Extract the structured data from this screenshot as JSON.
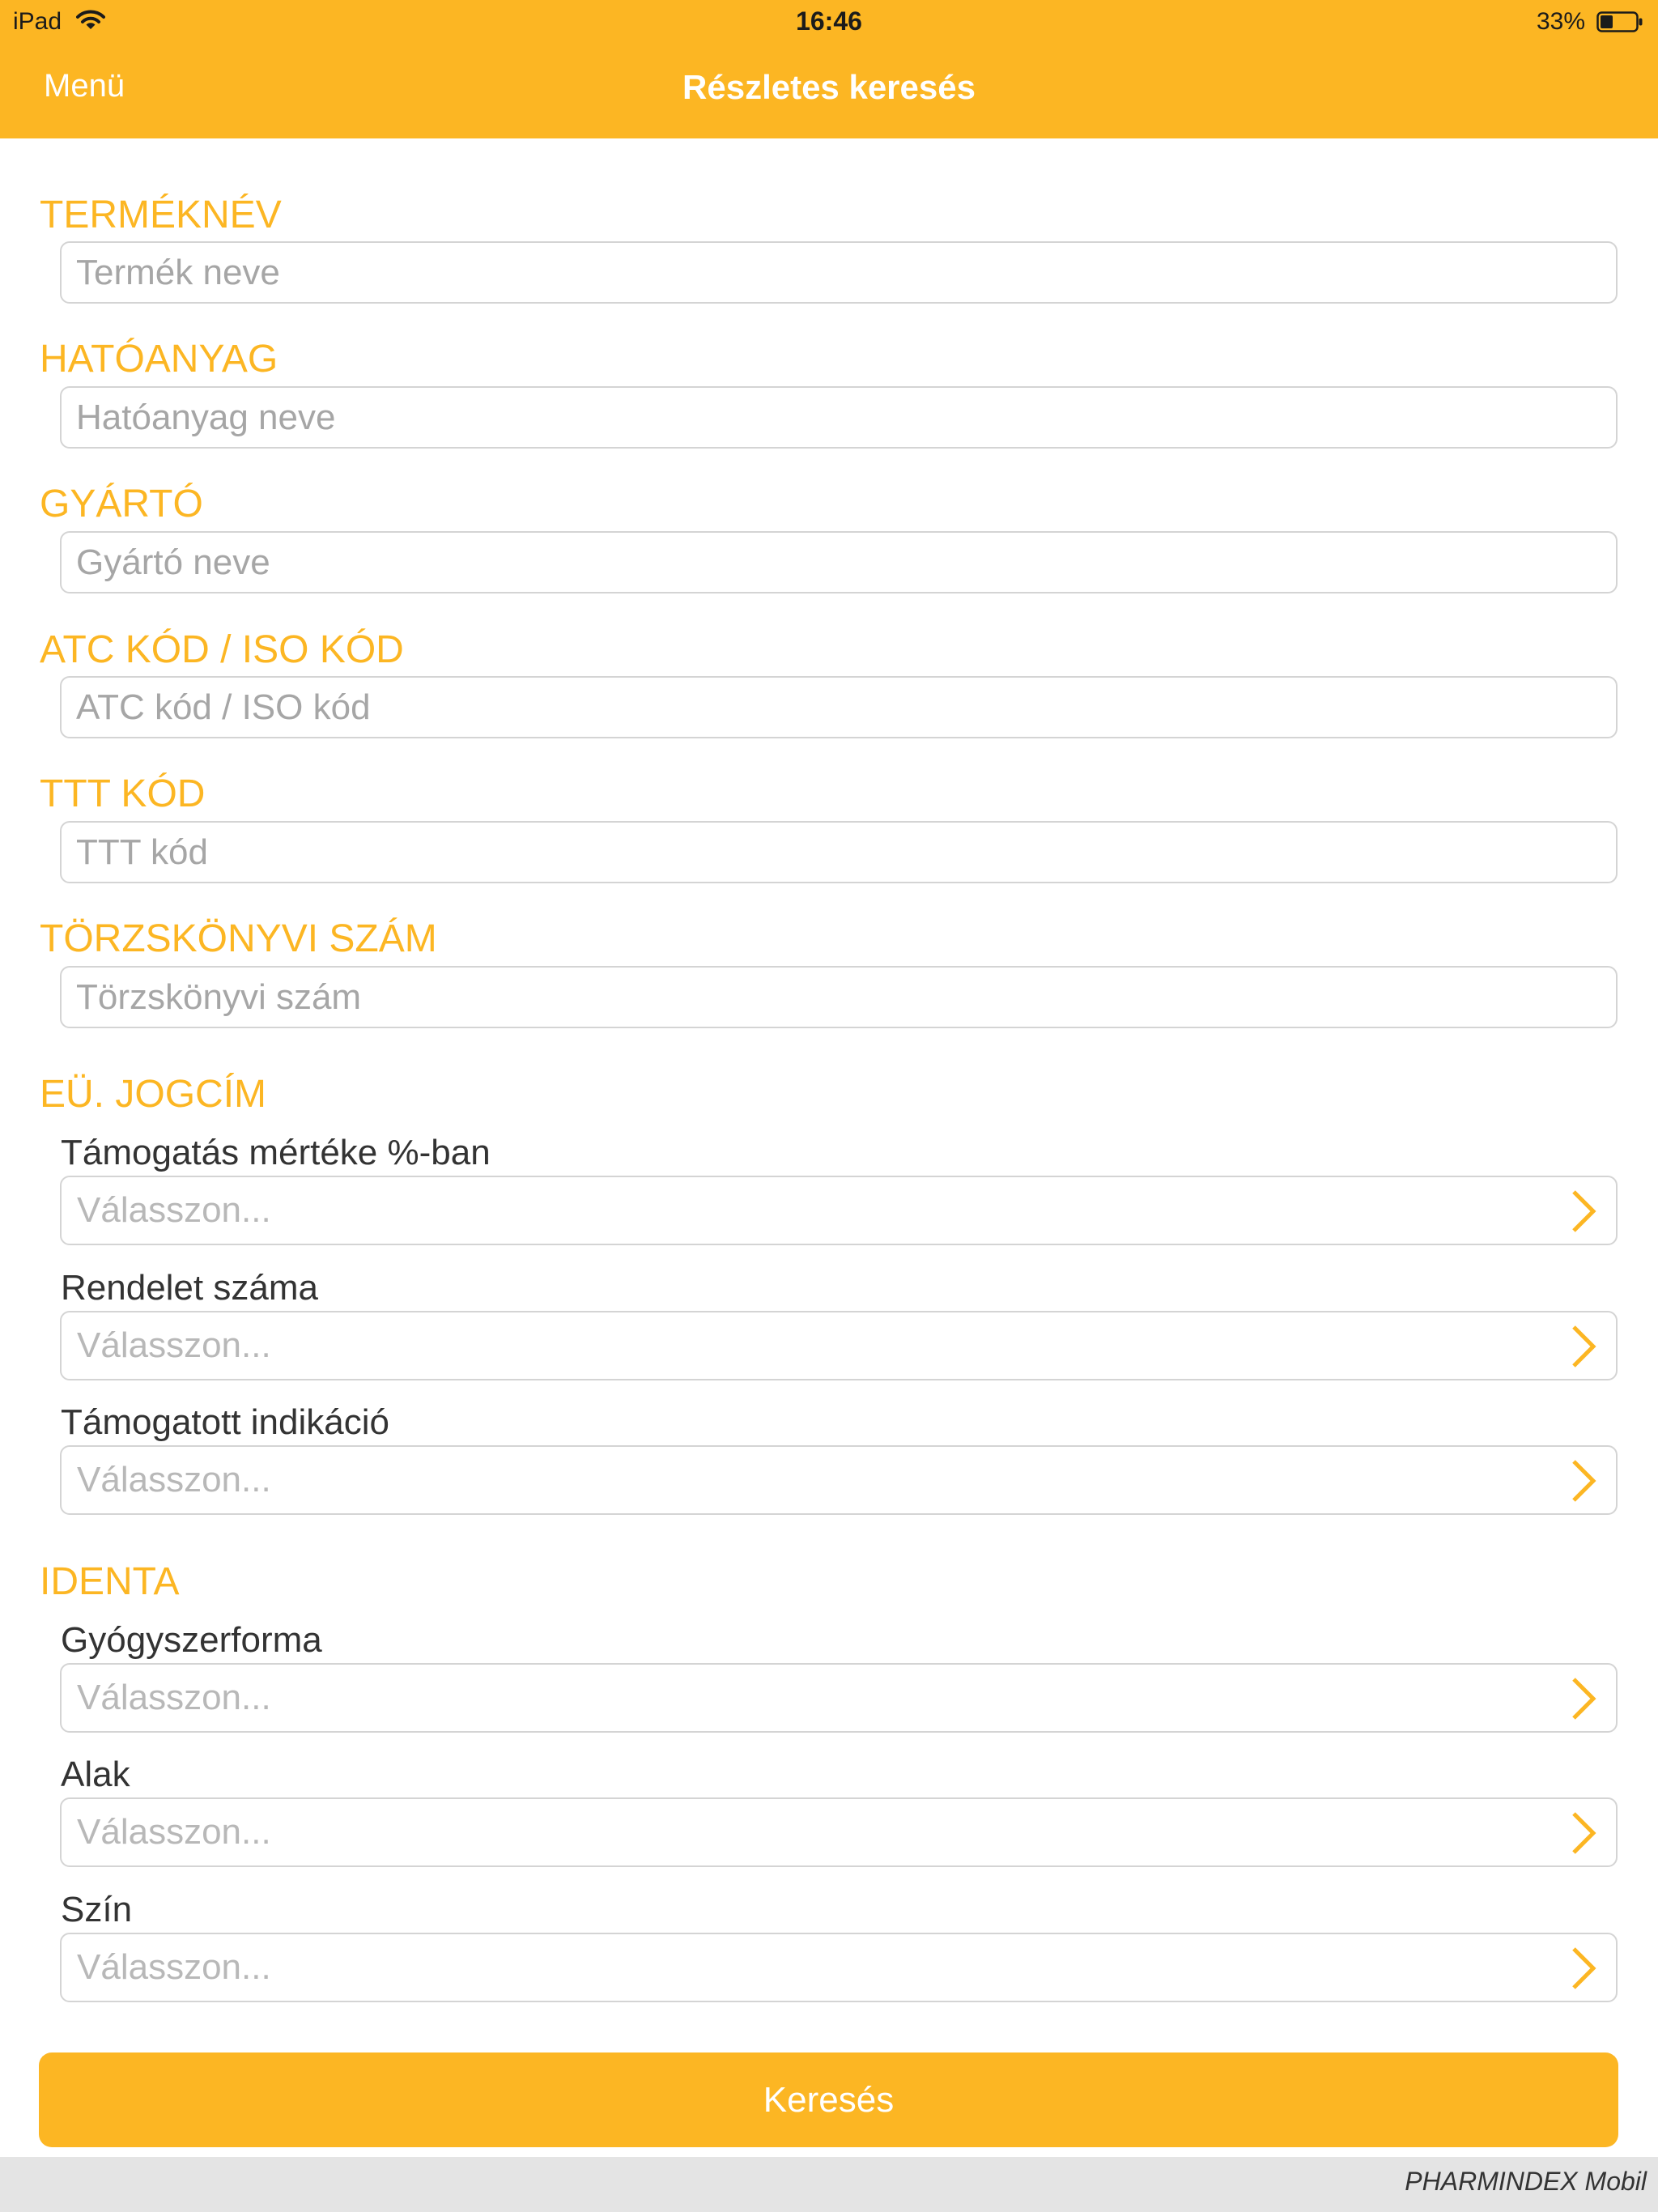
{
  "status_bar": {
    "device": "iPad",
    "time": "16:46",
    "battery": "33%"
  },
  "nav": {
    "menu_label": "Menü",
    "title": "Részletes keresés"
  },
  "fields": {
    "termeknev": {
      "label": "TERMÉKNÉV",
      "placeholder": "Termék neve"
    },
    "hatoanyag": {
      "label": "HATÓANYAG",
      "placeholder": "Hatóanyag neve"
    },
    "gyarto": {
      "label": "GYÁRTÓ",
      "placeholder": "Gyártó neve"
    },
    "atc": {
      "label": "ATC KÓD / ISO KÓD",
      "placeholder": "ATC kód / ISO kód"
    },
    "ttt": {
      "label": "TTT KÓD",
      "placeholder": "TTT kód"
    },
    "torzskonyvi": {
      "label": "TÖRZSKÖNYVI SZÁM",
      "placeholder": "Törzskönyvi szám"
    }
  },
  "eu_jogcim": {
    "label": "EÜ. JOGCÍM",
    "selects": [
      {
        "label": "Támogatás mértéke %-ban",
        "placeholder": "Válasszon..."
      },
      {
        "label": "Rendelet száma",
        "placeholder": "Válasszon..."
      },
      {
        "label": "Támogatott indikáció",
        "placeholder": "Válasszon..."
      }
    ]
  },
  "identa": {
    "label": "IDENTA",
    "selects": [
      {
        "label": "Gyógyszerforma",
        "placeholder": "Válasszon..."
      },
      {
        "label": "Alak",
        "placeholder": "Válasszon..."
      },
      {
        "label": "Szín",
        "placeholder": "Válasszon..."
      }
    ]
  },
  "search_button": "Keresés",
  "footer": {
    "brand": "PHARMINDEX Mobil"
  },
  "colors": {
    "accent": "#fcb623",
    "text": "#333333",
    "placeholder": "#b8b8b8",
    "border": "#d4d4d4",
    "footer_bg": "#e4e4e4"
  },
  "icons": {
    "wifi": "wifi-icon",
    "battery": "battery-icon",
    "chevron": "chevron-right-icon"
  }
}
